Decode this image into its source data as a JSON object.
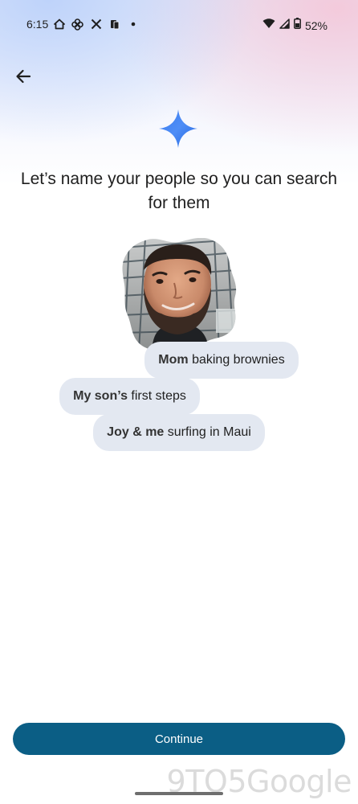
{
  "status_bar": {
    "time": "6:15",
    "battery": "52%",
    "left_icons": [
      "home-icon",
      "pinwheel-icon",
      "x-icon",
      "cards-icon",
      "dot-icon"
    ],
    "right_icons": [
      "wifi-icon",
      "cell-signal-icon",
      "battery-icon"
    ]
  },
  "header": {
    "back_icon": "arrow-left-icon",
    "sparkle_icon": "gemini-sparkle-icon"
  },
  "main": {
    "title": "Let’s name your people so you can search for them",
    "photo": "person-face-photo",
    "chips": [
      {
        "bold": "Mom",
        "rest": " baking brownies"
      },
      {
        "bold": "My son’s",
        "rest": " first steps"
      },
      {
        "bold": "Joy & me",
        "rest": " surfing in Maui"
      }
    ]
  },
  "footer": {
    "continue_label": "Continue"
  },
  "watermark": "9TO5Google",
  "colors": {
    "accent": "#0b5e85",
    "chip_bg": "#e3e8f1",
    "sparkle": "#4285f4"
  }
}
